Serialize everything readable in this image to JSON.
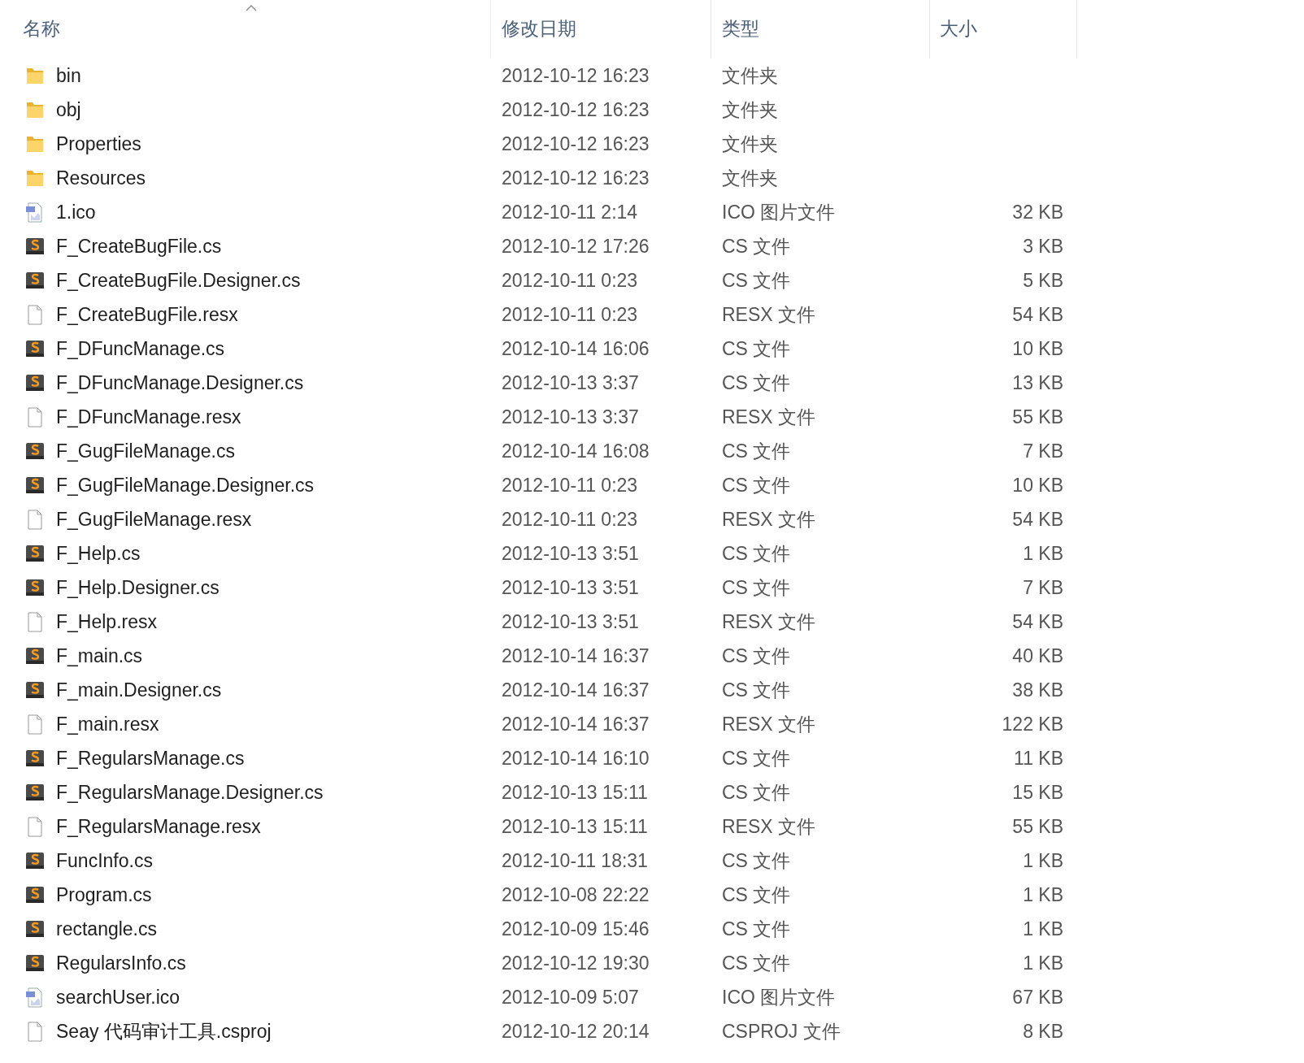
{
  "columns": [
    {
      "label": "名称",
      "sorted": true
    },
    {
      "label": "修改日期",
      "sorted": false
    },
    {
      "label": "类型",
      "sorted": false
    },
    {
      "label": "大小",
      "sorted": false
    }
  ],
  "files": [
    {
      "kind": "folder",
      "name": "bin",
      "modified": "2012-10-12 16:23",
      "type": "文件夹"
    },
    {
      "kind": "folder",
      "name": "obj",
      "modified": "2012-10-12 16:23",
      "type": "文件夹"
    },
    {
      "kind": "folder",
      "name": "Properties",
      "modified": "2012-10-12 16:23",
      "type": "文件夹"
    },
    {
      "kind": "folder",
      "name": "Resources",
      "modified": "2012-10-12 16:23",
      "type": "文件夹"
    },
    {
      "kind": "ico",
      "name": "1.ico",
      "modified": "2012-10-11 2:14",
      "type": "ICO 图片文件",
      "size": "32 KB"
    },
    {
      "kind": "cs",
      "name": "F_CreateBugFile.cs",
      "modified": "2012-10-12 17:26",
      "type": "CS 文件",
      "size": "3 KB"
    },
    {
      "kind": "cs",
      "name": "F_CreateBugFile.Designer.cs",
      "modified": "2012-10-11 0:23",
      "type": "CS 文件",
      "size": "5 KB"
    },
    {
      "kind": "file",
      "name": "F_CreateBugFile.resx",
      "modified": "2012-10-11 0:23",
      "type": "RESX 文件",
      "size": "54 KB"
    },
    {
      "kind": "cs",
      "name": "F_DFuncManage.cs",
      "modified": "2012-10-14 16:06",
      "type": "CS 文件",
      "size": "10 KB"
    },
    {
      "kind": "cs",
      "name": "F_DFuncManage.Designer.cs",
      "modified": "2012-10-13 3:37",
      "type": "CS 文件",
      "size": "13 KB"
    },
    {
      "kind": "file",
      "name": "F_DFuncManage.resx",
      "modified": "2012-10-13 3:37",
      "type": "RESX 文件",
      "size": "55 KB"
    },
    {
      "kind": "cs",
      "name": "F_GugFileManage.cs",
      "modified": "2012-10-14 16:08",
      "type": "CS 文件",
      "size": "7 KB"
    },
    {
      "kind": "cs",
      "name": "F_GugFileManage.Designer.cs",
      "modified": "2012-10-11 0:23",
      "type": "CS 文件",
      "size": "10 KB"
    },
    {
      "kind": "file",
      "name": "F_GugFileManage.resx",
      "modified": "2012-10-11 0:23",
      "type": "RESX 文件",
      "size": "54 KB"
    },
    {
      "kind": "cs",
      "name": "F_Help.cs",
      "modified": "2012-10-13 3:51",
      "type": "CS 文件",
      "size": "1 KB"
    },
    {
      "kind": "cs",
      "name": "F_Help.Designer.cs",
      "modified": "2012-10-13 3:51",
      "type": "CS 文件",
      "size": "7 KB"
    },
    {
      "kind": "file",
      "name": "F_Help.resx",
      "modified": "2012-10-13 3:51",
      "type": "RESX 文件",
      "size": "54 KB"
    },
    {
      "kind": "cs",
      "name": "F_main.cs",
      "modified": "2012-10-14 16:37",
      "type": "CS 文件",
      "size": "40 KB"
    },
    {
      "kind": "cs",
      "name": "F_main.Designer.cs",
      "modified": "2012-10-14 16:37",
      "type": "CS 文件",
      "size": "38 KB"
    },
    {
      "kind": "file",
      "name": "F_main.resx",
      "modified": "2012-10-14 16:37",
      "type": "RESX 文件",
      "size": "122 KB"
    },
    {
      "kind": "cs",
      "name": "F_RegularsManage.cs",
      "modified": "2012-10-14 16:10",
      "type": "CS 文件",
      "size": "11 KB"
    },
    {
      "kind": "cs",
      "name": "F_RegularsManage.Designer.cs",
      "modified": "2012-10-13 15:11",
      "type": "CS 文件",
      "size": "15 KB"
    },
    {
      "kind": "file",
      "name": "F_RegularsManage.resx",
      "modified": "2012-10-13 15:11",
      "type": "RESX 文件",
      "size": "55 KB"
    },
    {
      "kind": "cs",
      "name": "FuncInfo.cs",
      "modified": "2012-10-11 18:31",
      "type": "CS 文件",
      "size": "1 KB"
    },
    {
      "kind": "cs",
      "name": "Program.cs",
      "modified": "2012-10-08 22:22",
      "type": "CS 文件",
      "size": "1 KB"
    },
    {
      "kind": "cs",
      "name": "rectangle.cs",
      "modified": "2012-10-09 15:46",
      "type": "CS 文件",
      "size": "1 KB"
    },
    {
      "kind": "cs",
      "name": "RegularsInfo.cs",
      "modified": "2012-10-12 19:30",
      "type": "CS 文件",
      "size": "1 KB"
    },
    {
      "kind": "ico",
      "name": "searchUser.ico",
      "modified": "2012-10-09 5:07",
      "type": "ICO 图片文件",
      "size": "67 KB"
    },
    {
      "kind": "file",
      "name": "Seay 代码审计工具.csproj",
      "modified": "2012-10-12 20:14",
      "type": "CSPROJ 文件",
      "size": "8 KB"
    }
  ]
}
